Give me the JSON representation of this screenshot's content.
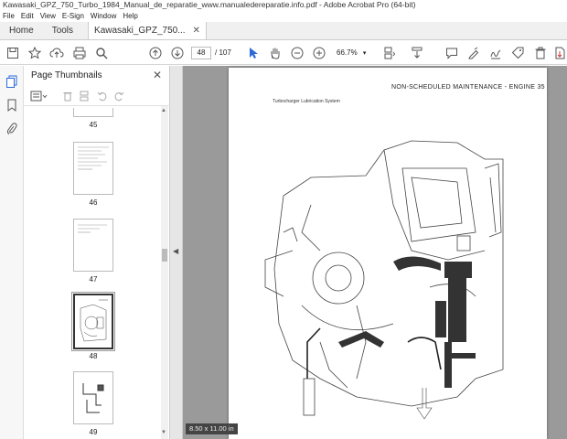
{
  "window": {
    "title": "Kawasaki_GPZ_750_Turbo_1984_Manual_de_reparatie_www.manualedereparatie.info.pdf - Adobe Acrobat Pro (64-bit)"
  },
  "menu": [
    "File",
    "Edit",
    "View",
    "E-Sign",
    "Window",
    "Help"
  ],
  "tabs": {
    "home": "Home",
    "tools": "Tools",
    "document": "Kawasaki_GPZ_750..."
  },
  "toolbar": {
    "page_current": "48",
    "page_total": "/ 107",
    "zoom": "66.7%"
  },
  "panel": {
    "title": "Page Thumbnails"
  },
  "thumbnails": [
    {
      "num": "45"
    },
    {
      "num": "46"
    },
    {
      "num": "47"
    },
    {
      "num": "48",
      "selected": true
    },
    {
      "num": "49"
    }
  ],
  "page": {
    "header": "NON-SCHEDULED MAINTENANCE - ENGINE 35",
    "subheader": "Turbocharger Lubrication System",
    "size": "8.50 x 11.00 in"
  }
}
